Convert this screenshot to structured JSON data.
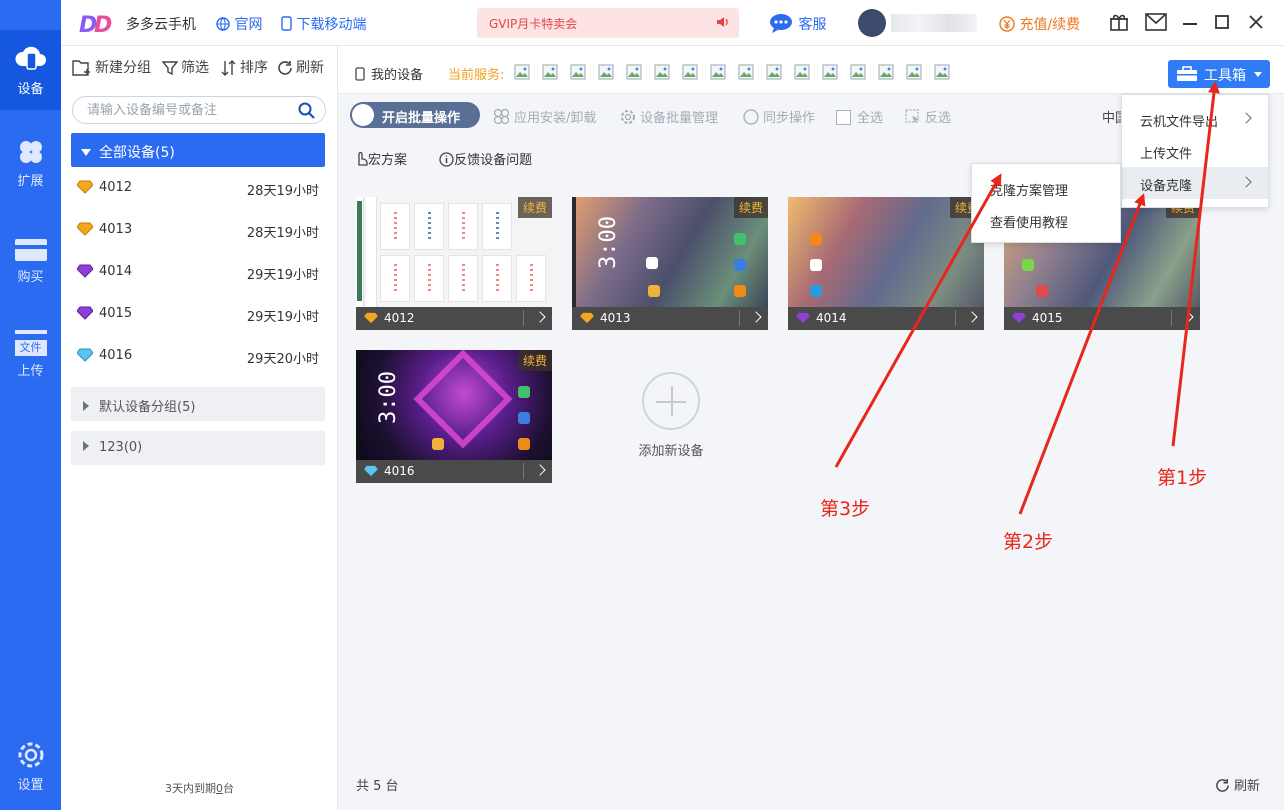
{
  "rail": {
    "items": [
      {
        "label": "设备",
        "icon": "cloud-phone-icon"
      },
      {
        "label": "扩展",
        "icon": "clover-icon"
      },
      {
        "label": "购买",
        "icon": "card-icon"
      },
      {
        "label": "上传",
        "icon": "file-icon",
        "icon_text": "文件"
      },
      {
        "label": "设置",
        "icon": "gear-icon"
      }
    ]
  },
  "topbar": {
    "app_name": "多多云手机",
    "website": "官网",
    "download": "下载移动端",
    "promo": "GVIP月卡特卖会",
    "service": "客服",
    "recharge": "充值/续费"
  },
  "sidebar": {
    "tools": [
      "新建分组",
      "筛选",
      "排序",
      "刷新"
    ],
    "search_placeholder": "请输入设备编号或备注",
    "group_all": "全部设备(5)",
    "devices": [
      {
        "id": "4012",
        "time": "28天19小时",
        "tier": "gold"
      },
      {
        "id": "4013",
        "time": "28天19小时",
        "tier": "gold"
      },
      {
        "id": "4014",
        "time": "29天19小时",
        "tier": "purple"
      },
      {
        "id": "4015",
        "time": "29天19小时",
        "tier": "purple"
      },
      {
        "id": "4016",
        "time": "29天20小时",
        "tier": "diamond"
      }
    ],
    "groups": [
      "默认设备分组(5)",
      "123(0)"
    ],
    "footer_prefix": "3天内到期",
    "footer_count": "0",
    "footer_suffix": "台"
  },
  "main": {
    "my_devices": "我的设备",
    "current_service": "当前服务:",
    "toolbox": "工具箱",
    "batch_toggle": "开启批量操作",
    "tools": [
      "应用安装/卸载",
      "设备批量管理",
      "同步操作",
      "全选",
      "反选"
    ],
    "partial_label": "中国",
    "sub_tools": [
      "宏方案",
      "反馈设备问题"
    ],
    "renew_badge": "续费",
    "cards": [
      {
        "id": "4012",
        "tier": "gold"
      },
      {
        "id": "4013",
        "tier": "gold",
        "clock": "3:00"
      },
      {
        "id": "4014",
        "tier": "purple"
      },
      {
        "id": "4015",
        "tier": "purple"
      },
      {
        "id": "4016",
        "tier": "diamond",
        "clock": "3:00"
      }
    ],
    "add_device": "添加新设备",
    "total": "共 5 台",
    "refresh": "刷新"
  },
  "toolbox_menu": {
    "items": [
      "云机文件导出",
      "上传文件",
      "设备克隆"
    ]
  },
  "clone_submenu": {
    "items": [
      "克隆方案管理",
      "查看使用教程"
    ]
  },
  "annotations": [
    "第1步",
    "第2步",
    "第3步"
  ],
  "colors": {
    "brand": "#2a6bf2",
    "annotation": "#e8261c",
    "renew": "#f6b43a",
    "recharge": "#f0761b"
  }
}
